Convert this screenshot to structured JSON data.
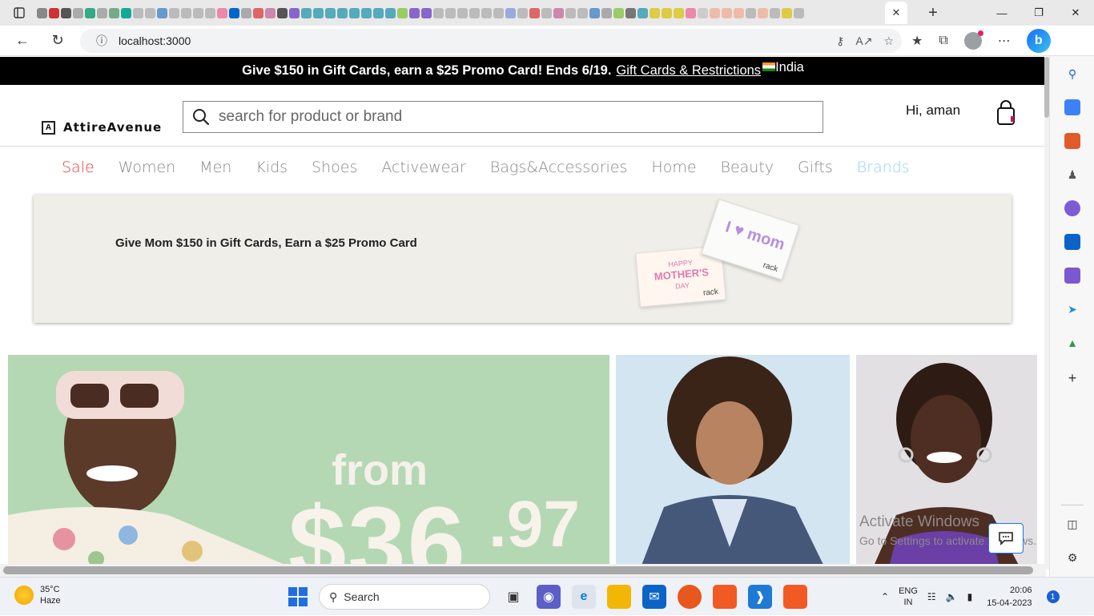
{
  "browser": {
    "url": "localhost:3000",
    "active_tab_close": "✕",
    "new_tab": "+"
  },
  "promo": {
    "message": "Give $150 in Gift Cards, earn a $25 Promo Card! Ends 6/19.",
    "link": "Gift Cards & Restrictions",
    "country": "India"
  },
  "header": {
    "logo_mark": "A",
    "logo_text": "AttireAvenue",
    "search_placeholder": "search for product or brand",
    "greeting": "Hi, aman"
  },
  "categories": [
    "Sale",
    "Women",
    "Men",
    "Kids",
    "Shoes",
    "Activewear",
    "Bags&Accessories",
    "Home",
    "Beauty",
    "Gifts",
    "Brands"
  ],
  "gift_banner": {
    "text": "Give Mom $150 in Gift Cards, Earn a $25 Promo Card",
    "card1_title_1": "HAPPY",
    "card1_title_2": "MOTHER'S",
    "card1_title_3": "DAY",
    "card1_brand": "rack",
    "card2_title": "I ♥ mom",
    "card2_brand": "rack"
  },
  "hero": {
    "from": "from",
    "price": "$36",
    "cents": ".97"
  },
  "watermark": {
    "line1": "Activate Windows",
    "line2": "Go to Settings to activate Windows."
  },
  "taskbar": {
    "temp": "35°C",
    "condition": "Haze",
    "search": "Search",
    "lang1": "ENG",
    "lang2": "IN",
    "time": "20:06",
    "date": "15-04-2023",
    "notif_count": "1"
  },
  "colors": {
    "sale": "#e53935",
    "brands": "#8fd3f4",
    "hero_green": "#b4d8b3",
    "promo_bg": "#000000"
  }
}
